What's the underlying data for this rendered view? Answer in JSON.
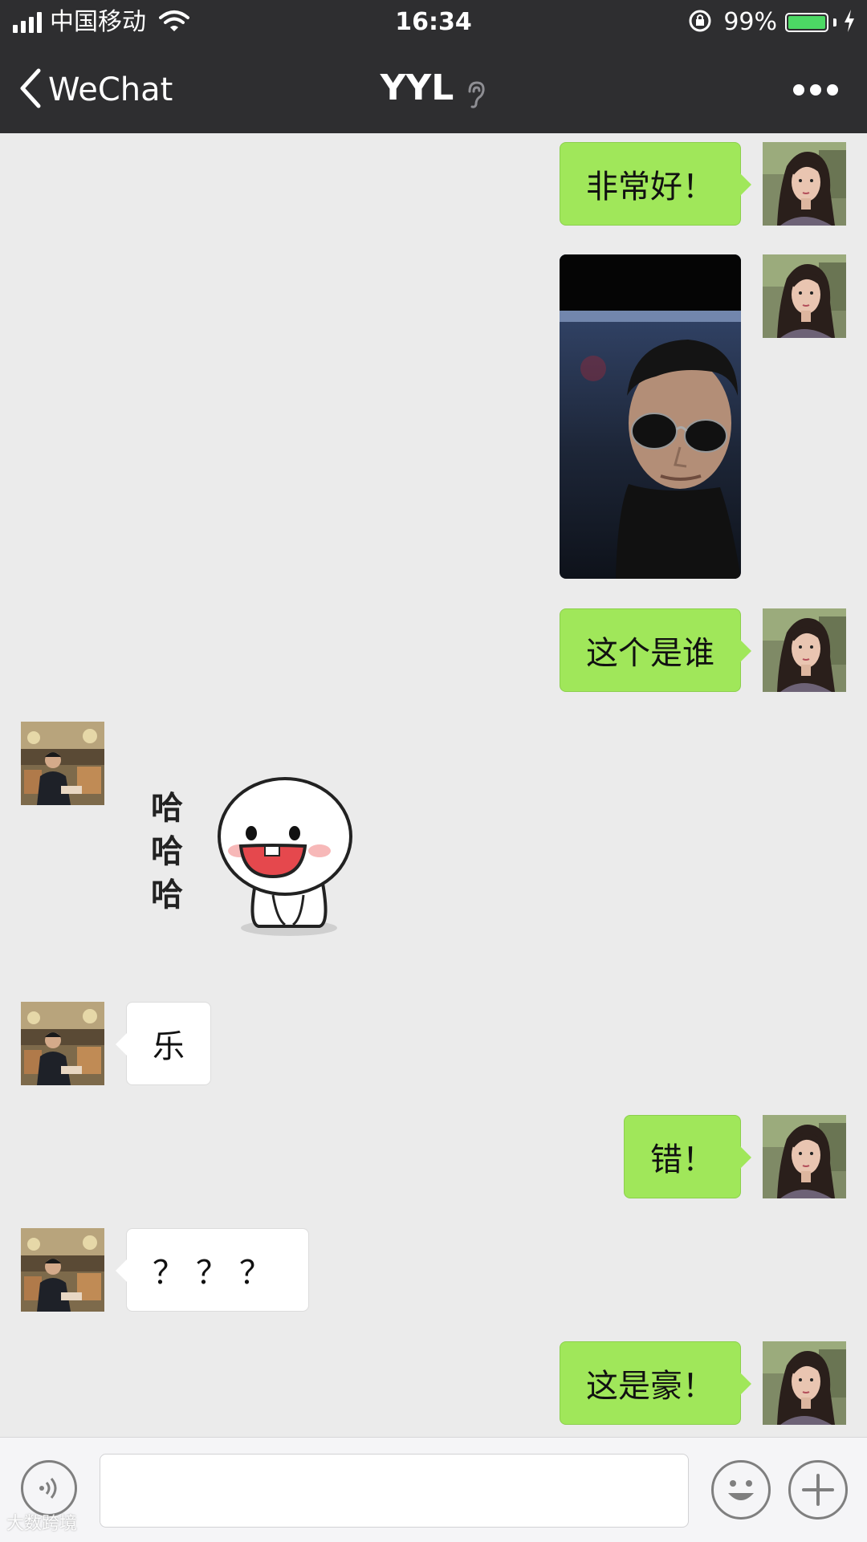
{
  "status_bar": {
    "carrier": "中国移动",
    "time": "16:34",
    "battery": "99%",
    "battery_level": 0.99,
    "signal_bars": 4
  },
  "nav": {
    "back_label": "WeChat",
    "title": "YYL",
    "more_icon": "more-dots-icon",
    "mute_icon": "ear-icon"
  },
  "messages": [
    {
      "side": "out",
      "type": "text",
      "text": "非常好！"
    },
    {
      "side": "out",
      "type": "image",
      "icon": "photo-man-sunglasses"
    },
    {
      "side": "out",
      "type": "text",
      "text": "这个是谁"
    },
    {
      "side": "in",
      "type": "sticker",
      "text": "哈哈哈"
    },
    {
      "side": "in",
      "type": "text",
      "text": "乐"
    },
    {
      "side": "out",
      "type": "text",
      "text": "错！"
    },
    {
      "side": "in",
      "type": "text",
      "text": "？？？"
    },
    {
      "side": "out",
      "type": "text",
      "text": "这是豪！"
    }
  ],
  "input_bar": {
    "voice_icon": "voice-icon",
    "emoji_icon": "emoji-icon",
    "plus_icon": "plus-icon",
    "input_value": ""
  },
  "watermark": "大数跨境",
  "colors": {
    "header_bg": "#2e2e30",
    "chat_bg": "#ebebeb",
    "outgoing_bubble": "#a0e75a",
    "incoming_bubble": "#ffffff",
    "battery": "#4cd964"
  }
}
